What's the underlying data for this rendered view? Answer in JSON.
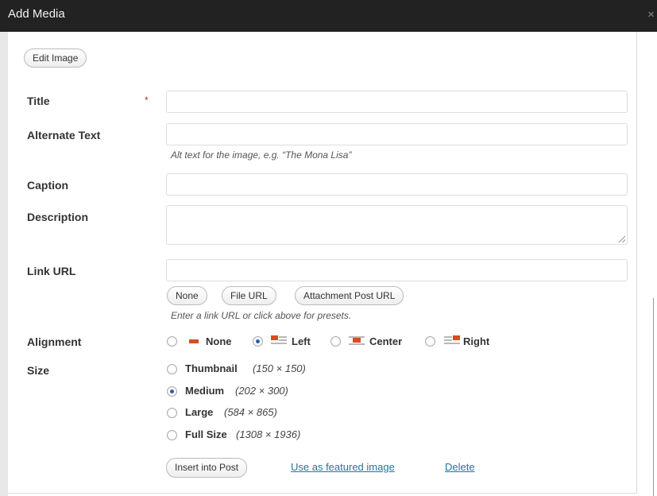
{
  "window": {
    "title": "Add Media",
    "close_glyph": "×"
  },
  "toolbar": {
    "edit_image_label": "Edit Image"
  },
  "form": {
    "title": {
      "label": "Title",
      "required_mark": "*",
      "value": ""
    },
    "alt_text": {
      "label": "Alternate Text",
      "value": "",
      "help": "Alt text for the image, e.g. “The Mona Lisa”"
    },
    "caption": {
      "label": "Caption",
      "value": ""
    },
    "description": {
      "label": "Description",
      "value": ""
    },
    "link_url": {
      "label": "Link URL",
      "value": "",
      "presets": [
        "None",
        "File URL",
        "Attachment Post URL"
      ],
      "help": "Enter a link URL or click above for presets."
    },
    "alignment": {
      "label": "Alignment",
      "selected": "Left",
      "options": [
        "None",
        "Left",
        "Center",
        "Right"
      ],
      "icon_colors": {
        "block": "#d54e21",
        "lines": "#b8b8b8"
      }
    },
    "size": {
      "label": "Size",
      "selected": "Medium",
      "options": [
        {
          "name": "Thumbnail",
          "dims": "(150 × 150)"
        },
        {
          "name": "Medium",
          "dims": "(202 × 300)"
        },
        {
          "name": "Large",
          "dims": "(584 × 865)"
        },
        {
          "name": "Full Size",
          "dims": "(1308 × 1936)"
        }
      ]
    }
  },
  "actions": {
    "insert_label": "Insert into Post",
    "featured_label": "Use as featured image",
    "delete_label": "Delete",
    "link_color": "#21759b"
  }
}
